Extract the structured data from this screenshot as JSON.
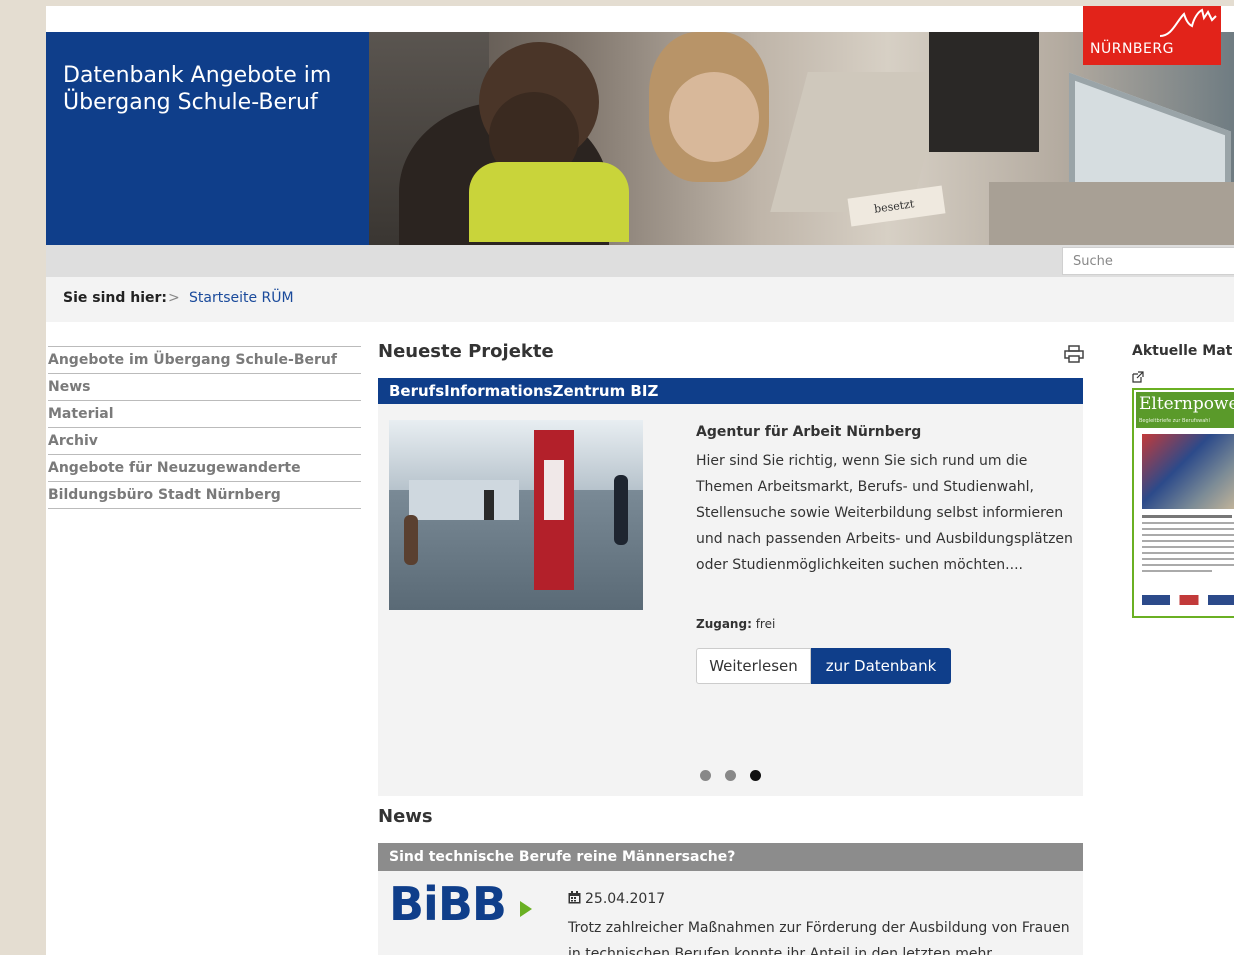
{
  "header": {
    "site_title": "Datenbank Angebote im Übergang Schule-Beruf",
    "logo_text": "NÜRNBERG",
    "hero_sign_text": "besetzt"
  },
  "search": {
    "placeholder": "Suche"
  },
  "breadcrumb": {
    "label": "Sie sind hier:",
    "separator": ">",
    "current": "Startseite RÜM"
  },
  "sidenav": {
    "items": [
      "Angebote im Übergang Schule-Beruf",
      "News",
      "Material",
      "Archiv",
      "Angebote für Neuzugewanderte",
      "Bildungsbüro Stadt Nürnberg"
    ]
  },
  "projects": {
    "heading": "Neueste Projekte",
    "title": "BerufsInformationsZentrum BIZ",
    "subtitle": "Agentur für Arbeit Nürnberg",
    "text": "Hier sind Sie richtig, wenn Sie sich rund um die Themen Arbeitsmarkt, Berufs- und Studienwahl, Stellensuche sowie Weiterbildung selbst informieren und nach passenden Arbeits- und Ausbildungsplätzen oder Studienmöglichkeiten suchen möchten....",
    "access_label": "Zugang:",
    "access_value": "frei",
    "btn_more": "Weiterlesen",
    "btn_db": "zur Datenbank",
    "carousel": {
      "count": 3,
      "active": 3
    }
  },
  "news": {
    "heading": "News",
    "title": "Sind technische Berufe reine Männersache?",
    "logo_text": "BiBB",
    "date": "25.04.2017",
    "text": "Trotz zahlreicher Maßnahmen zur Förderung der Ausbildung von Frauen in technischen Berufen konnte ihr Anteil in den letzten mehr"
  },
  "material": {
    "heading": "Aktuelle Mat",
    "cover_title": "Elternpower",
    "cover_subtitle": "Begleitbriefe zur Berufswahl"
  },
  "colors": {
    "brand_blue": "#0f3e8a",
    "city_red": "#e2231a",
    "news_bar_gray": "#8c8c8c",
    "accent_green": "#6ab023"
  },
  "icons": [
    "print-icon",
    "external-link-icon",
    "calendar-icon"
  ]
}
